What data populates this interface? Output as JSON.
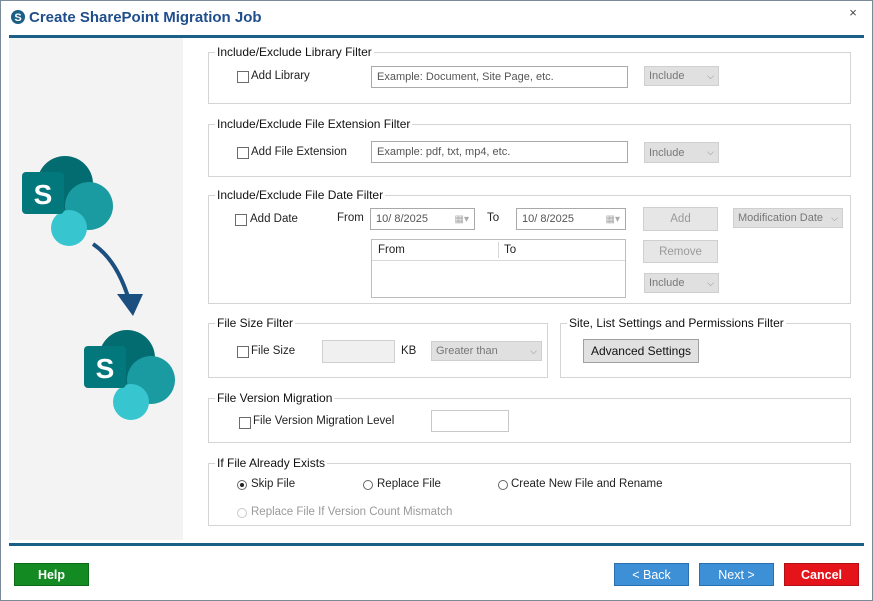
{
  "window": {
    "title": "Create SharePoint Migration Job",
    "close_glyph": "×"
  },
  "library_filter": {
    "legend": "Include/Exclude Library Filter",
    "checkbox_label": "Add Library",
    "placeholder": "Example: Document, Site Page, etc.",
    "mode": "Include"
  },
  "extension_filter": {
    "legend": "Include/Exclude File Extension Filter",
    "checkbox_label": "Add File  Extension",
    "placeholder": "Example: pdf, txt, mp4, etc.",
    "mode": "Include"
  },
  "date_filter": {
    "legend": "Include/Exclude File Date Filter",
    "checkbox_label": "Add Date",
    "from_label": "From",
    "from_value": "10/  8/2025",
    "to_label": "To",
    "to_value": "10/  8/2025",
    "add_button": "Add",
    "remove_button": "Remove",
    "date_type": "Modification Date",
    "mode": "Include",
    "table_headers": [
      "From",
      "To"
    ]
  },
  "size_filter": {
    "legend": "File Size Filter",
    "checkbox_label": "File Size",
    "unit": "KB",
    "comparison": "Greater than"
  },
  "permissions_filter": {
    "legend": "Site, List Settings and Permissions Filter",
    "button": "Advanced Settings"
  },
  "version_migration": {
    "legend": "File Version Migration",
    "checkbox_label": "File Version Migration Level"
  },
  "if_exists": {
    "legend": "If File Already Exists",
    "options": [
      "Skip File",
      "Replace File",
      "Create New File and Rename"
    ],
    "selected": "Skip File",
    "disabled_option": "Replace File If Version Count Mismatch"
  },
  "footer": {
    "help": "Help",
    "back": "< Back",
    "next": "Next >",
    "cancel": "Cancel"
  },
  "colors": {
    "title": "#1f4e8c",
    "rule": "#1b5e86",
    "help": "#138a22",
    "nav": "#3d8fd6",
    "cancel": "#e5141b",
    "sharepoint_dark": "#036c70",
    "sharepoint_mid": "#1a9ba1",
    "sharepoint_light": "#37c6d0"
  }
}
